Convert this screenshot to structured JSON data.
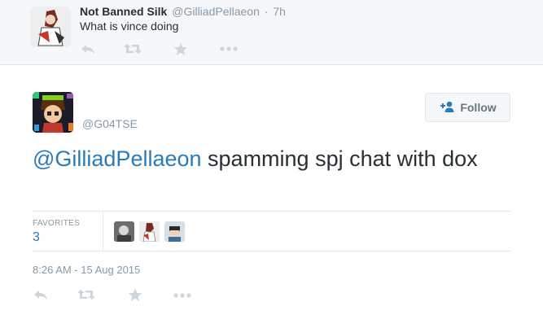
{
  "parent_tweet": {
    "name": "Not Banned Silk",
    "handle": "@GilliadPellaeon",
    "separator": "·",
    "time": "7h",
    "text": "What is vince doing"
  },
  "main_tweet": {
    "handle": "@G04TSE",
    "follow_label": "Follow",
    "mention": "@GilliadPellaeon",
    "text": " spamming spj chat with dox",
    "favorites_label": "FAVORITES",
    "favorites_count": "3",
    "timestamp": "8:26 AM - 15 Aug 2015"
  },
  "icons": {
    "reply": "reply-icon",
    "retweet": "retweet-icon",
    "favorite": "star-icon",
    "more": "more-icon",
    "follow": "add-user-icon"
  },
  "colors": {
    "link": "#2b7bb9",
    "muted": "#8899a6",
    "action_icon": "#ccd6dd",
    "text": "#292f33",
    "parent_bg": "#f5f8fa"
  }
}
